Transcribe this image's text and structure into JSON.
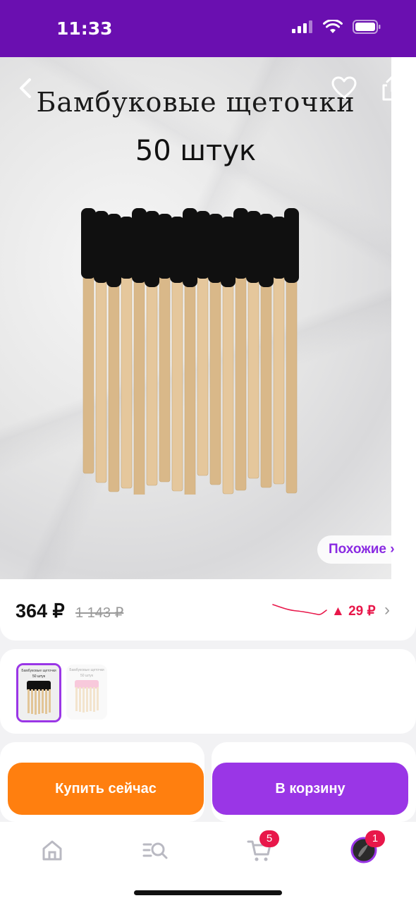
{
  "status": {
    "time": "11:33"
  },
  "product": {
    "image_title": "Бамбуковые щеточки",
    "image_subtitle": "50 штук",
    "similar_label": "Похожие ›"
  },
  "price": {
    "current": "364 ₽",
    "old": "1 143 ₽",
    "change": "▲ 29 ₽"
  },
  "thumbs": {
    "first_title": "Бамбуковые щеточки",
    "first_sub": "50 штук",
    "second_title": "Бамбуковые щеточки",
    "second_sub": "50 штук"
  },
  "actions": {
    "buy_now": "Купить сейчас",
    "add_to_cart": "В корзину"
  },
  "tabbar": {
    "cart_badge": "5",
    "profile_badge": "1"
  },
  "colors": {
    "brand_purple": "#9a36e6",
    "status_purple": "#6a0fb0",
    "buy_orange": "#ff7f0f",
    "price_change_red": "#e8174a"
  }
}
